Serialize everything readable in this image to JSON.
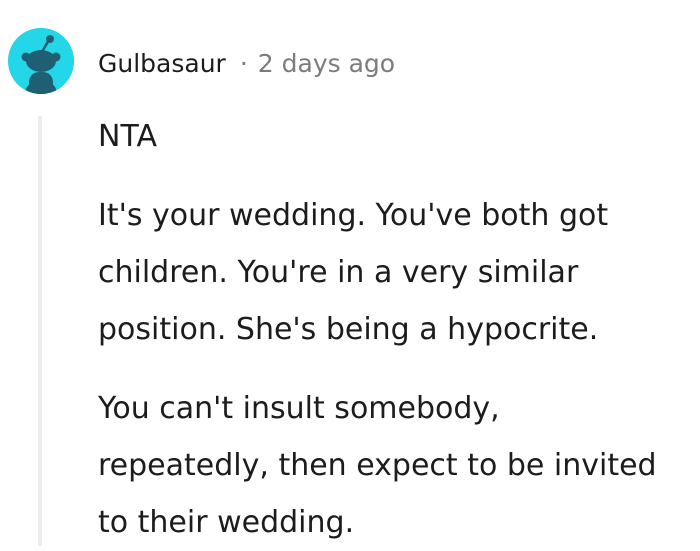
{
  "comment": {
    "author": "Gulbasaur",
    "separator": "·",
    "timestamp": "2 days ago",
    "avatar_icon": "reddit-snoo-avatar-icon",
    "avatar_bg": "#24d7e8",
    "paragraphs": [
      {
        "lines": [
          "NTA"
        ]
      },
      {
        "lines": [
          "It's your wedding. You've both got",
          "children. You're in a very similar",
          "position. She's being a hypocrite."
        ]
      },
      {
        "lines": [
          "You can't insult somebody,",
          "repeatedly, then expect to be invited",
          "to their wedding."
        ]
      }
    ]
  },
  "colors": {
    "text": "#1c1c1c",
    "meta": "#7c7c7c",
    "thread_line": "#ededed"
  }
}
